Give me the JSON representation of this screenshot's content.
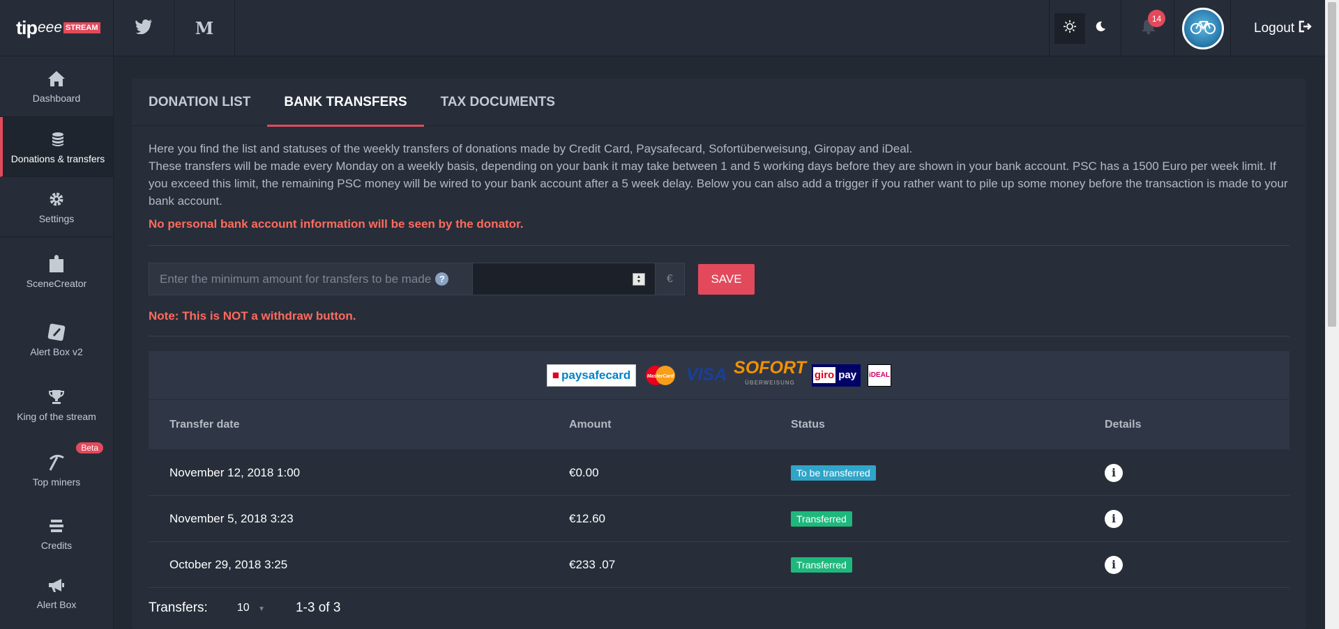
{
  "brand": {
    "name": "tip",
    "eee": "eee",
    "badge": "STREAM"
  },
  "sidebar": {
    "items": [
      {
        "label": "Dashboard",
        "icon": "home-icon"
      },
      {
        "label": "Donations & transfers",
        "icon": "coins-icon"
      },
      {
        "label": "Settings",
        "icon": "gear-icon"
      },
      {
        "label": "SceneCreator",
        "icon": "puzzle-icon"
      },
      {
        "label": "Alert Box v2",
        "icon": "alert-box-icon"
      },
      {
        "label": "King of the stream",
        "icon": "trophy-icon"
      },
      {
        "label": "Top miners",
        "icon": "pickaxe-icon",
        "badge": "Beta"
      },
      {
        "label": "Credits",
        "icon": "credits-icon"
      },
      {
        "label": "Alert Box",
        "icon": "megaphone-icon"
      }
    ]
  },
  "topbar": {
    "social": [
      {
        "icon": "twitter-icon"
      },
      {
        "icon": "medium-icon",
        "label": "M"
      }
    ],
    "notifications": {
      "count": "14"
    },
    "logout_label": "Logout"
  },
  "tabs": [
    {
      "label": "DONATION LIST",
      "active": false
    },
    {
      "label": "BANK TRANSFERS",
      "active": true
    },
    {
      "label": "TAX DOCUMENTS",
      "active": false
    }
  ],
  "content": {
    "desc_line1": "Here you find the list and statuses of the weekly transfers of donations made by Credit Card, Paysafecard, Sofortüberweisung, Giropay and iDeal.",
    "desc_line2": "These transfers will be made every Monday on a weekly basis, depending on your bank it may take between 1 and 5 working days before they are shown in your bank account. PSC has a 1500 Euro per week limit. If you exceed this limit, the remaining PSC money will be wired to your bank account after a 5 week delay. Below you can also add a trigger if you rather want to pile up some money before the transaction is made to your bank account.",
    "warning": "No personal bank account information will be seen by the donator.",
    "min_amount_label": "Enter the minimum amount for transfers to be made",
    "help_glyph": "?",
    "currency": "€",
    "save_label": "SAVE",
    "note": "Note: This is NOT a withdraw button."
  },
  "payment_logos": {
    "paysafecard": "paysafecard",
    "mastercard": "MasterCard",
    "visa": "VISA",
    "sofort": "SOFORT",
    "sofort_sub": "ÜBERWEISUNG",
    "giro": "giro",
    "pay": "pay",
    "ideal": "iDEAL"
  },
  "table": {
    "headers": [
      "Transfer date",
      "Amount",
      "Status",
      "Details"
    ],
    "rows": [
      {
        "date": "November 12, 2018 1:00",
        "amount": "€0.00",
        "status": "To be transferred",
        "status_color": "#30a5c9"
      },
      {
        "date": "November 5, 2018 3:23",
        "amount": "€12.60",
        "status": "Transferred",
        "status_color": "#1eb87d"
      },
      {
        "date": "October 29, 2018 3:25",
        "amount": "€233 .07",
        "status": "Transferred",
        "status_color": "#1eb87d"
      }
    ]
  },
  "footer": {
    "label": "Transfers:",
    "per_page": "10",
    "range": "1-3 of 3"
  },
  "colors": {
    "accent": "#e24a5c",
    "pending": "#30a5c9",
    "done": "#1eb87d",
    "warning": "#ff6b5e"
  }
}
